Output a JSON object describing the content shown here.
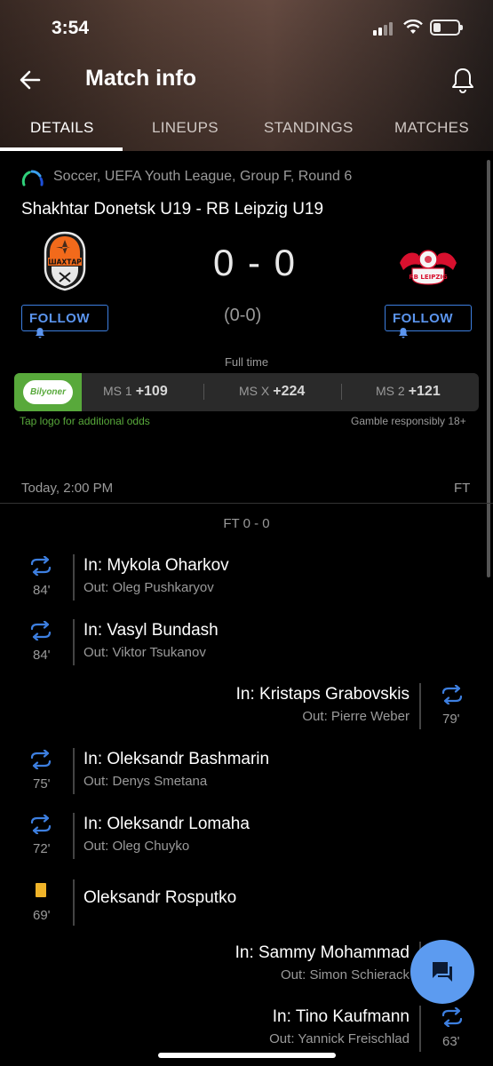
{
  "status_bar": {
    "time": "3:54"
  },
  "app_bar": {
    "title": "Match info"
  },
  "tabs": [
    {
      "label": "DETAILS",
      "active": true
    },
    {
      "label": "LINEUPS",
      "active": false
    },
    {
      "label": "STANDINGS",
      "active": false
    },
    {
      "label": "MATCHES",
      "active": false
    }
  ],
  "match": {
    "league": "Soccer, UEFA Youth League, Group F, Round 6",
    "title": "Shakhtar Donetsk U19 - RB Leipzig U19",
    "home_crest_text": "ШАХТАР",
    "away_crest_text": "RB LEIPZIG",
    "score": "0 - 0",
    "half_time_score": "(0-0)",
    "status": "Full time",
    "follow_label": "FOLLOW",
    "date": "Today, 2:00 PM",
    "period": "FT",
    "ft_score": "FT 0 - 0"
  },
  "odds": {
    "brand": "Bilyoner",
    "items": [
      {
        "label": "MS 1",
        "value": "+109"
      },
      {
        "label": "MS X",
        "value": "+224"
      },
      {
        "label": "MS 2",
        "value": "+121"
      }
    ],
    "note_left": "Tap logo for additional odds",
    "note_right": "Gamble responsibly 18+"
  },
  "events": [
    {
      "side": "left",
      "type": "substitution",
      "minute": "84'",
      "in": "In: Mykola Oharkov",
      "out": "Out: Oleg Pushkaryov"
    },
    {
      "side": "left",
      "type": "substitution",
      "minute": "84'",
      "in": "In: Vasyl Bundash",
      "out": "Out: Viktor Tsukanov"
    },
    {
      "side": "right",
      "type": "substitution",
      "minute": "79'",
      "in": "In: Kristaps Grabovskis",
      "out": "Out: Pierre Weber"
    },
    {
      "side": "left",
      "type": "substitution",
      "minute": "75'",
      "in": "In: Oleksandr Bashmarin",
      "out": "Out: Denys Smetana"
    },
    {
      "side": "left",
      "type": "substitution",
      "minute": "72'",
      "in": "In: Oleksandr Lomaha",
      "out": "Out: Oleg Chuyko"
    },
    {
      "side": "left",
      "type": "yellow-card",
      "minute": "69'",
      "player": "Oleksandr Rosputko"
    },
    {
      "side": "right",
      "type": "substitution",
      "minute": "",
      "in": "In: Sammy Mohammad",
      "out": "Out: Simon Schierack"
    },
    {
      "side": "right",
      "type": "substitution",
      "minute": "63'",
      "in": "In: Tino Kaufmann",
      "out": "Out: Yannick Freischlad"
    }
  ],
  "colors": {
    "accent": "#5c9bf0",
    "odds_green": "#58a93b",
    "yellow_card": "#f0b429",
    "background": "#000000"
  }
}
